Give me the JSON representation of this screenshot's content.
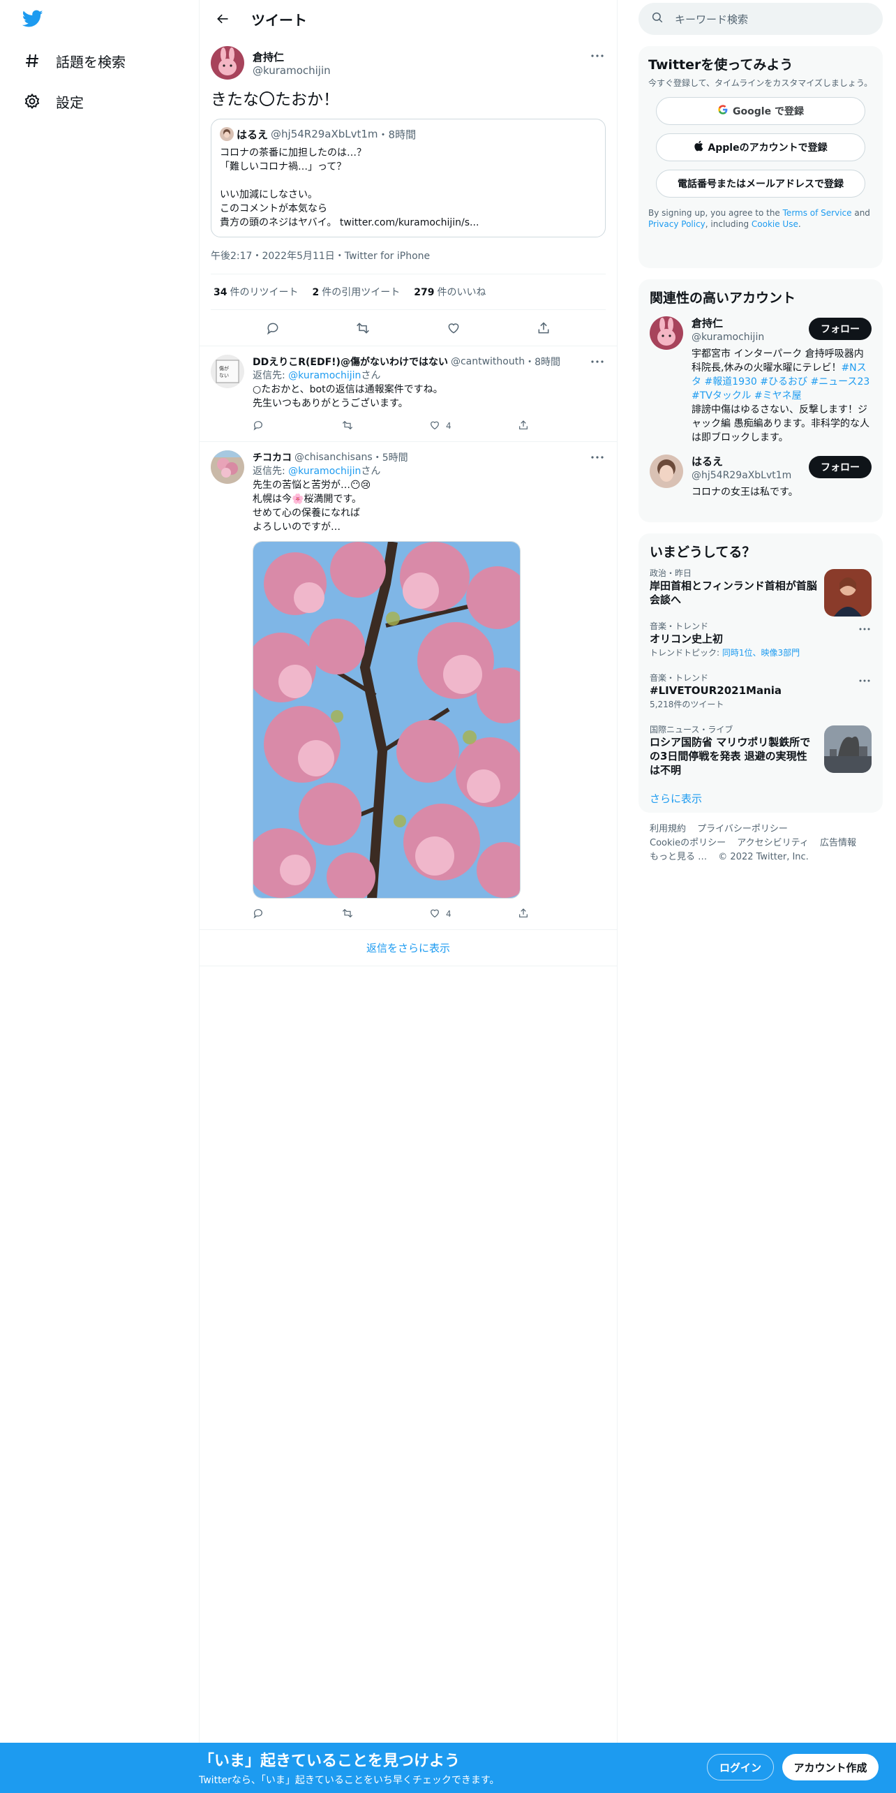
{
  "colors": {
    "accent": "#1d9bf0",
    "text": "#0f1419",
    "muted": "#536471",
    "border": "#eff3f4"
  },
  "nav": {
    "logo_icon": "twitter-bird-icon",
    "items": [
      {
        "label": "話題を検索",
        "icon": "hashtag-icon"
      },
      {
        "label": "設定",
        "icon": "gear-icon"
      }
    ]
  },
  "header": {
    "title": "ツイート"
  },
  "focus_tweet": {
    "display_name": "倉持仁",
    "handle": "@kuramochijin",
    "text": "きたな〇たおか！",
    "quote": {
      "display_name": "はるえ",
      "handle": "@hj54R29aXbLvt1m",
      "time": "・8時間",
      "lines": [
        "コロナの茶番に加担したのは…？",
        "「難しいコロナ禍…」って？",
        "",
        "いい加減にしなさい。",
        "このコメントが本気なら",
        "貴方の頭のネジはヤバイ。 twitter.com/kuramochijin/s..."
      ]
    },
    "timestamp": "午後2:17・2022年5月11日・Twitter for iPhone",
    "stats": {
      "retweets_count": "34",
      "retweets_label": "件のリツイート",
      "quotes_count": "2",
      "quotes_label": "件の引用ツイート",
      "likes_count": "279",
      "likes_label": "件のいいね"
    }
  },
  "replies": [
    {
      "display_name": "DDえりこR(EDF!)@傷がないわけではない",
      "handle": "@cantwithouth",
      "time": "・8時間",
      "reply_prefix": "返信先: ",
      "reply_to": "@kuramochijin",
      "reply_suffix": "さん",
      "lines": [
        "○たおかと、botの返信は通報案件ですね。",
        "先生いつもありがとうございます。"
      ],
      "likes": "4"
    },
    {
      "display_name": "チコカコ",
      "handle": "@chisanchisans",
      "time": "・5時間",
      "reply_prefix": "返信先: ",
      "reply_to": "@kuramochijin",
      "reply_suffix": "さん",
      "lines": [
        "先生の苦悩と苦労が…😶😢",
        "札幌は今🌸桜満開です。",
        "せめて心の保養になれば",
        "よろしいのですが…"
      ],
      "likes": "4"
    }
  ],
  "show_more_replies": "返信をさらに表示",
  "search": {
    "placeholder": "キーワード検索"
  },
  "signup_card": {
    "title": "Twitterを使ってみよう",
    "subtitle": "今すぐ登録して、タイムラインをカスタマイズしましょう。",
    "google": "Google で登録",
    "apple": "Appleのアカウントで登録",
    "phone": "電話番号またはメールアドレスで登録",
    "legal_prefix": "By signing up, you agree to the ",
    "terms": "Terms of Service",
    "and": " and ",
    "privacy": "Privacy Policy",
    "including": ", including ",
    "cookie": "Cookie Use",
    "end": "."
  },
  "related": {
    "title": "関連性の高いアカウント",
    "accounts": [
      {
        "name": "倉持仁",
        "handle": "@kuramochijin",
        "bio_text": "宇都宮市 インターパーク 倉持呼吸器内科院長,休みの火曜水曜にテレビ！",
        "bio_tags": "#Nスタ #報道1930 #ひるおび #ニュース23 #TVタックル #ミヤネ屋",
        "bio_tail": "誹謗中傷はゆるさない、反撃します！ジャック編 愚痴編あります。非科学的な人は即ブロックします。",
        "follow": "フォロー"
      },
      {
        "name": "はるえ",
        "handle": "@hj54R29aXbLvt1m",
        "bio_text": "コロナの女王は私です。",
        "follow": "フォロー"
      }
    ]
  },
  "trends": {
    "title": "いまどうしてる？",
    "items": [
      {
        "category": "政治・昨日",
        "title": "岸田首相とフィンランド首相が首脳会談へ"
      },
      {
        "category": "音楽・トレンド",
        "title": "オリコン史上初",
        "sub_prefix": "トレンドトピック: ",
        "sub_link": "同時1位、映像3部門"
      },
      {
        "category": "音楽・トレンド",
        "title": "#LIVETOUR2021Mania",
        "sub": "5,218件のツイート"
      },
      {
        "category": "国際ニュース・ライブ",
        "title": "ロシア国防省 マリウポリ製鉄所での3日間停戦を発表 退避の実現性は不明"
      }
    ],
    "show_more": "さらに表示"
  },
  "footer": {
    "links": [
      "利用規約",
      "プライバシーポリシー",
      "Cookieのポリシー",
      "アクセシビリティ",
      "広告情報",
      "もっと見る …",
      "© 2022 Twitter, Inc."
    ]
  },
  "banner": {
    "title": "「いま」起きていることを見つけよう",
    "subtitle": "Twitterなら、「いま」起きていることをいち早くチェックできます。",
    "login": "ログイン",
    "signup": "アカウント作成"
  }
}
